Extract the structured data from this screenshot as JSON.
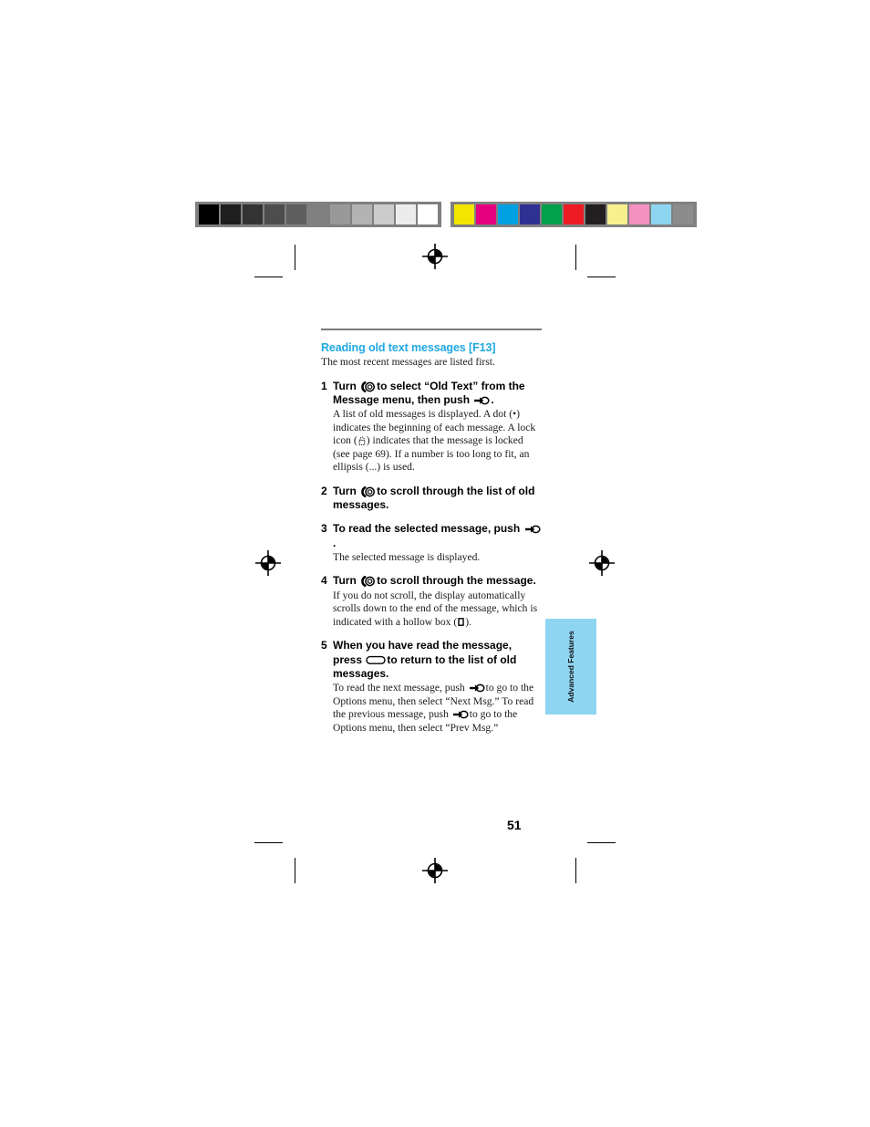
{
  "page": {
    "number": "51",
    "side_tab": "Advanced Features"
  },
  "section": {
    "heading": "Reading old text messages [F13]",
    "intro": "The most recent messages are listed first."
  },
  "steps": [
    {
      "number": "1",
      "title_part1": "Turn",
      "icon1": "jog-dial-turn-icon",
      "title_part2": "to select “Old Text” from the Message menu, then push",
      "icon2": "jog-dial-push-icon",
      "title_part3": ".",
      "description": "A list of old messages is displayed. A dot (•) indicates the beginning of each message. A lock icon ( ) indicates that the message is locked (see page 69). If a number is too long to fit, an ellipsis (...) is used."
    },
    {
      "number": "2",
      "title_part1": "Turn",
      "icon1": "jog-dial-turn-icon",
      "title_part2": "to scroll through the list of old messages.",
      "description": ""
    },
    {
      "number": "3",
      "title_part1": "To read the selected message, push",
      "icon1": "jog-dial-push-icon",
      "title_part2": ".",
      "description": "The selected message is displayed."
    },
    {
      "number": "4",
      "title_part1": "Turn",
      "icon1": "jog-dial-turn-icon",
      "title_part2": "to scroll through the message.",
      "description": "If you do not scroll, the display automatically scrolls down to the end of the message, which is indicated with a hollow box ( )."
    },
    {
      "number": "5",
      "title_part1": "When you have read the message, press",
      "icon1": "back-button-icon",
      "title_part2": "to return to the list of old messages.",
      "desc_a": "To read the next message, push",
      "desc_icon1": "jog-dial-push-icon",
      "desc_b": "to go to the Options menu, then select “Next Msg.” To read the previous message, push",
      "desc_icon2": "jog-dial-push-icon",
      "desc_c": "to go to the Options menu, then select “Prev Msg.”"
    }
  ],
  "prepress": {
    "gray_bar": [
      "#000000",
      "#1e1e1e",
      "#333333",
      "#4d4d4d",
      "#5e5e5e",
      "#808080",
      "#999999",
      "#b3b3b3",
      "#cccccc",
      "#ececec",
      "#ffffff"
    ],
    "color_bar": [
      "#f4e500",
      "#e6007e",
      "#00a0e2",
      "#2e3192",
      "#00a14b",
      "#ed1c24",
      "#231f20",
      "#f9ef8d",
      "#f391c0",
      "#8ed5f2",
      "#8c8c8c"
    ],
    "bar_backing": "#808080"
  },
  "colors": {
    "heading": "#1fa8e0",
    "rule": "#7a7a7a",
    "tab": "#8ed5f2"
  }
}
